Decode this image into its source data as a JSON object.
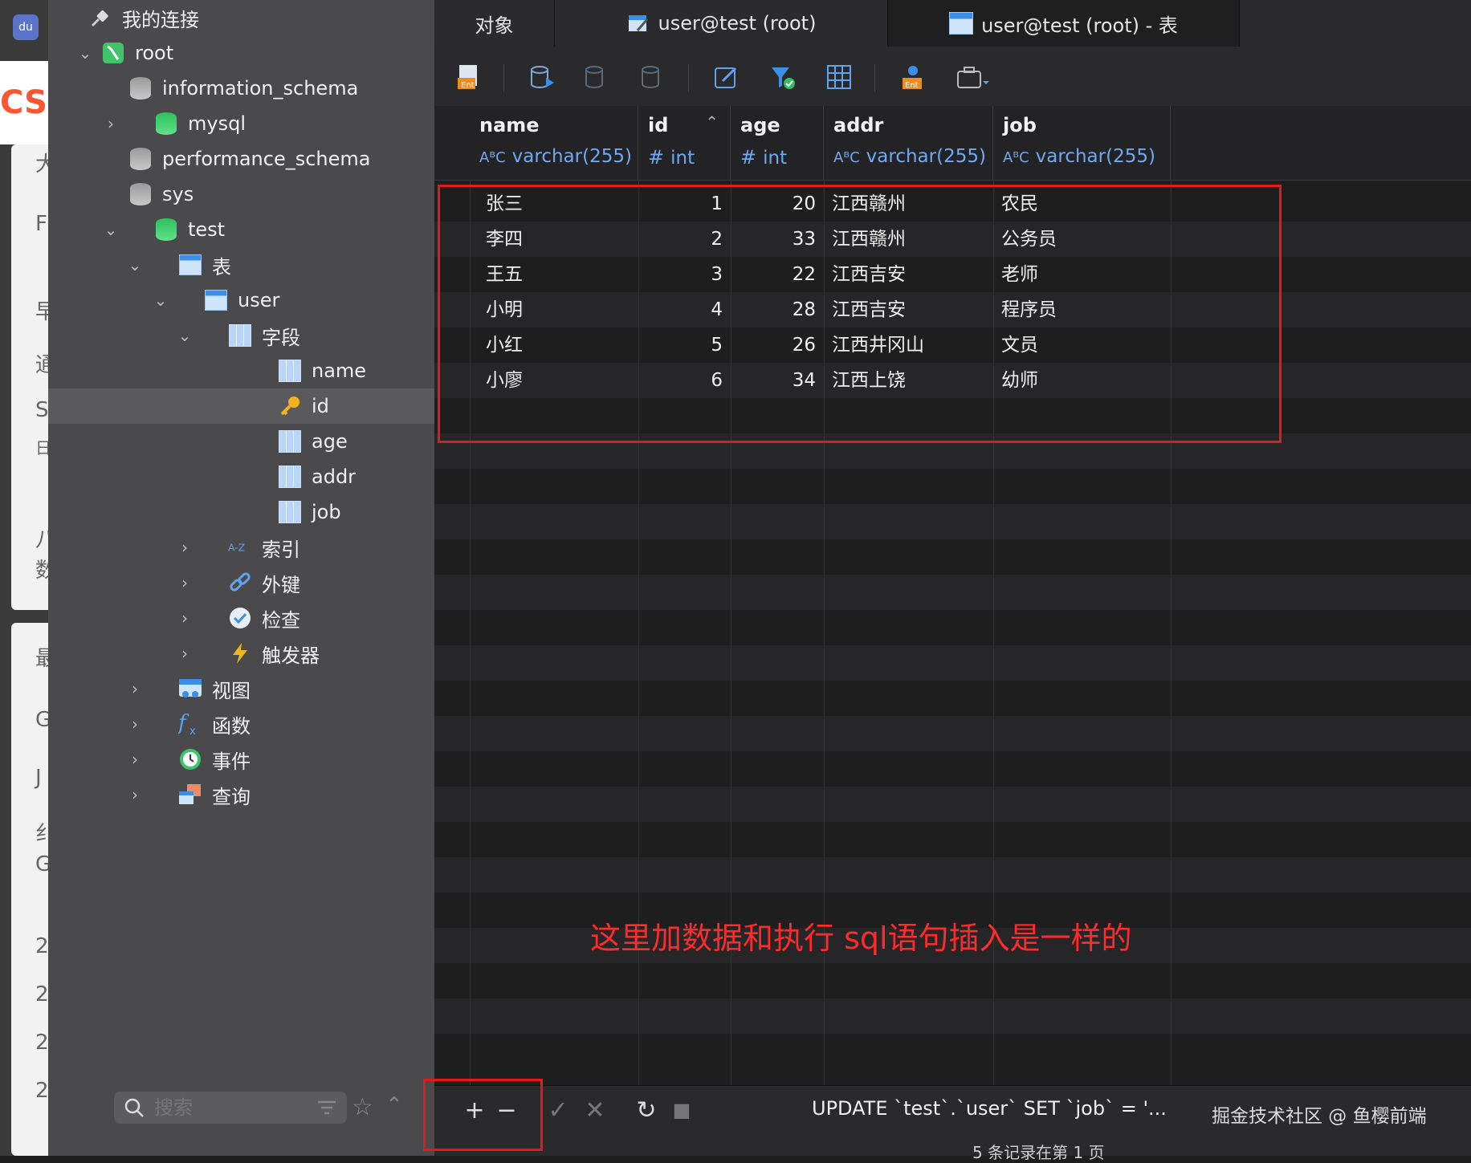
{
  "background_app": {
    "letters": [
      "CSD",
      "大",
      "F",
      "早",
      "通",
      "S",
      "日",
      "八",
      "数",
      "最",
      "G",
      "J",
      "纟",
      "G",
      "2",
      "2",
      "2",
      "2"
    ]
  },
  "sidebar": {
    "connection_root_label": "我的连接",
    "tree": [
      {
        "label": "root",
        "chevron": "down",
        "icon": "server-icon"
      },
      {
        "label": "information_schema",
        "chevron": "",
        "icon": "database-icon"
      },
      {
        "label": "mysql",
        "chevron": "right",
        "icon": "database-icon"
      },
      {
        "label": "performance_schema",
        "chevron": "",
        "icon": "database-icon"
      },
      {
        "label": "sys",
        "chevron": "",
        "icon": "database-icon"
      },
      {
        "label": "test",
        "chevron": "down",
        "icon": "database-icon"
      },
      {
        "label": "表",
        "chevron": "down",
        "icon": "tables-icon"
      },
      {
        "label": "user",
        "chevron": "down",
        "icon": "table-icon"
      },
      {
        "label": "字段",
        "chevron": "down",
        "icon": "fields-icon"
      },
      {
        "label": "name",
        "chevron": "",
        "icon": "field-icon"
      },
      {
        "label": "id",
        "chevron": "",
        "icon": "key-icon"
      },
      {
        "label": "age",
        "chevron": "",
        "icon": "field-icon"
      },
      {
        "label": "addr",
        "chevron": "",
        "icon": "field-icon"
      },
      {
        "label": "job",
        "chevron": "",
        "icon": "field-icon"
      },
      {
        "label": "索引",
        "chevron": "right",
        "icon": "index-icon"
      },
      {
        "label": "外键",
        "chevron": "right",
        "icon": "foreign-key-icon"
      },
      {
        "label": "检查",
        "chevron": "right",
        "icon": "check-icon"
      },
      {
        "label": "触发器",
        "chevron": "right",
        "icon": "trigger-icon"
      },
      {
        "label": "视图",
        "chevron": "right",
        "icon": "view-icon"
      },
      {
        "label": "函数",
        "chevron": "right",
        "icon": "function-icon"
      },
      {
        "label": "事件",
        "chevron": "right",
        "icon": "event-icon"
      },
      {
        "label": "查询",
        "chevron": "right",
        "icon": "query-icon"
      }
    ],
    "search_placeholder": "搜索",
    "selected_item": "id"
  },
  "tabs": [
    {
      "label": "对象",
      "active": false
    },
    {
      "label": "user@test (root)",
      "active": false
    },
    {
      "label": "user@test (root) - 表",
      "active": true
    }
  ],
  "toolbar": {
    "icons": [
      "export-entity-icon",
      "run-db-icon",
      "db-check-icon",
      "db-refresh-icon",
      "edit-icon",
      "filter-icon",
      "grid-icon",
      "entity-icon",
      "toolbox-icon"
    ]
  },
  "grid": {
    "columns": [
      {
        "name": "name",
        "type": "varchar(255)",
        "type_icon": "AᴮC"
      },
      {
        "name": "id",
        "type": "int",
        "type_icon": "#",
        "sorted": "ascending"
      },
      {
        "name": "age",
        "type": "int",
        "type_icon": "#"
      },
      {
        "name": "addr",
        "type": "varchar(255)",
        "type_icon": "AᴮC"
      },
      {
        "name": "job",
        "type": "varchar(255)",
        "type_icon": "AᴮC"
      }
    ],
    "rows": [
      [
        "张三",
        "1",
        "20",
        "江西赣州",
        "农民"
      ],
      [
        "李四",
        "2",
        "33",
        "江西赣州",
        "公务员"
      ],
      [
        "王五",
        "3",
        "22",
        "江西吉安",
        "老师"
      ],
      [
        "小明",
        "4",
        "28",
        "江西吉安",
        "程序员"
      ],
      [
        "小红",
        "5",
        "26",
        "江西井冈山",
        "文员"
      ],
      [
        "小廖",
        "6",
        "34",
        "江西上饶",
        "幼师"
      ]
    ]
  },
  "annotation": {
    "text": "这里加数据和执行 sql语句插入是一样的",
    "color": "#e21a1a"
  },
  "bottom_bar": {
    "add_label": "+",
    "remove_label": "−",
    "apply_label": "✓",
    "discard_label": "✕",
    "refresh_label": "↻",
    "stop_label": "■",
    "sql_status": "UPDATE `test`.`user` SET `job` = '...",
    "watermark": "掘金技术社区 @ 鱼樱前端",
    "records": "5 条记录在第 1 页"
  }
}
